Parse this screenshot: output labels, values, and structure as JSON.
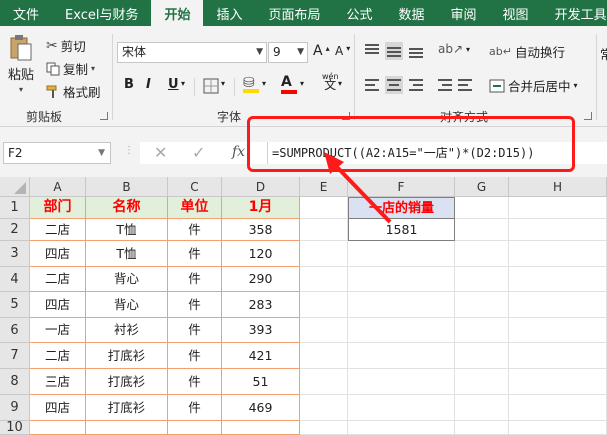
{
  "tabs": [
    "文件",
    "Excel与财务",
    "开始",
    "插入",
    "页面布局",
    "公式",
    "数据",
    "审阅",
    "视图",
    "开发工具"
  ],
  "active_tab": "开始",
  "ribbon": {
    "clipboard": {
      "paste": "粘贴",
      "cut": "剪切",
      "copy": "复制",
      "format_painter": "格式刷",
      "group_label": "剪贴板"
    },
    "font": {
      "font_name": "宋体",
      "font_size": "9",
      "group_label": "字体",
      "bold": "B",
      "italic": "I",
      "underline": "U",
      "grow": "A",
      "shrink": "A",
      "font_color": "A",
      "phonetic": "wén"
    },
    "alignment": {
      "wrap_text": "自动换行",
      "merge_center": "合并后居中",
      "group_label": "对齐方式"
    },
    "cut_off_label": "常"
  },
  "formula_bar": {
    "name_box": "F2",
    "fx": "fx",
    "formula": "=SUMPRODUCT((A2:A15=\"一店\")*(D2:D15))"
  },
  "columns": [
    "A",
    "B",
    "C",
    "D",
    "E",
    "F",
    "G",
    "H"
  ],
  "row_numbers": [
    "1",
    "2",
    "3",
    "4",
    "5",
    "6",
    "7",
    "8",
    "9",
    "10"
  ],
  "table": {
    "headers": [
      "部门",
      "名称",
      "单位",
      "1月"
    ],
    "rows": [
      [
        "二店",
        "T恤",
        "件",
        "358"
      ],
      [
        "四店",
        "T恤",
        "件",
        "120"
      ],
      [
        "二店",
        "背心",
        "件",
        "290"
      ],
      [
        "四店",
        "背心",
        "件",
        "283"
      ],
      [
        "一店",
        "衬衫",
        "件",
        "393"
      ],
      [
        "二店",
        "打底衫",
        "件",
        "421"
      ],
      [
        "三店",
        "打底衫",
        "件",
        "51"
      ],
      [
        "四店",
        "打底衫",
        "件",
        "469"
      ]
    ]
  },
  "summary": {
    "header": "一店的销量",
    "value": "1581"
  },
  "colors": {
    "ribbon_green": "#217346",
    "header_fill": "#e2efda",
    "summary_fill": "#d9e1f2",
    "header_text": "#ff0000",
    "callout_red": "#ff1a1a"
  }
}
